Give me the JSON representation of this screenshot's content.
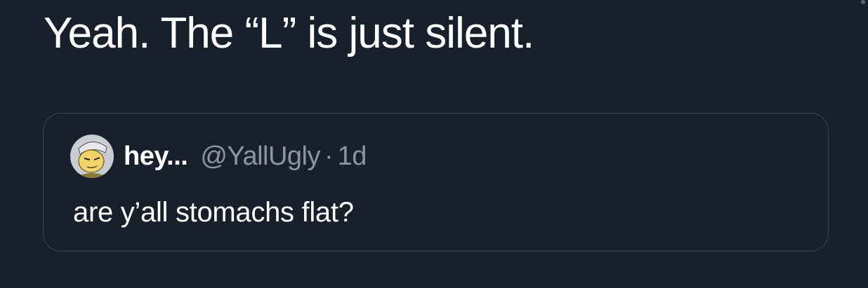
{
  "tweet": {
    "text": "Yeah. The “L” is just silent."
  },
  "quoted_tweet": {
    "display_name": "hey...",
    "handle": "@YallUgly",
    "separator": "·",
    "time": "1d",
    "text": "are y’all stomachs flat?",
    "avatar_icon": "cartoon-character-avatar"
  },
  "colors": {
    "background": "#18202b",
    "text_primary": "#ffffff",
    "text_secondary": "#8a96a3",
    "card_border": "#3a4450"
  }
}
